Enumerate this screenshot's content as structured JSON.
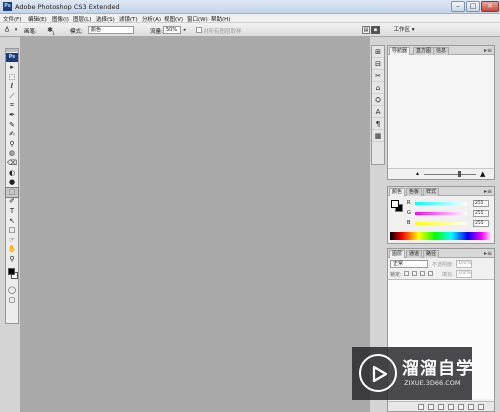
{
  "window": {
    "app_icon": "Ps",
    "title": "Adobe Photoshop CS3 Extended",
    "minimize": "–",
    "maximize": "□",
    "close": "✕"
  },
  "menu": [
    "文件(F)",
    "编辑(E)",
    "图像(I)",
    "图层(L)",
    "选择(S)",
    "滤镜(T)",
    "分析(A)",
    "视图(V)",
    "窗口(W)",
    "帮助(H)"
  ],
  "options_bar": {
    "brush_label": "画笔:",
    "brush_size": "1",
    "mode_label": "模式:",
    "mode_value": "颜色",
    "opacity_label": "流量:",
    "opacity_value": "50%",
    "sample_all_label": "对所有图层取样",
    "workspace_label": "工作区 ▾"
  },
  "toolbox": {
    "logo": "Ps",
    "tools": [
      "▸",
      "⬚",
      "ℓ",
      "⟋",
      "⌗",
      "✒",
      "✎",
      "✍",
      "⚲",
      "◍",
      "⌫",
      "◐",
      "●",
      "⬚",
      "✐",
      "T",
      "↖",
      "□",
      "☞",
      "✋",
      "⚲",
      "▣"
    ],
    "selected_index": 13,
    "extra": [
      "◯",
      "▢"
    ]
  },
  "icon_strip": [
    "⊞",
    "⊟",
    "✂",
    "⌂",
    "⛭",
    "A",
    "¶",
    "▦"
  ],
  "navigator": {
    "tabs": [
      "导航器",
      "直方图",
      "信息"
    ],
    "menu": "▸≡",
    "zoom_min": "▴",
    "zoom_max": "▲"
  },
  "color_panel": {
    "tabs": [
      "颜色",
      "色板",
      "样式"
    ],
    "menu": "▸≡",
    "channels": [
      {
        "label": "R",
        "value": "255"
      },
      {
        "label": "G",
        "value": "255"
      },
      {
        "label": "B",
        "value": "255"
      }
    ]
  },
  "layers_panel": {
    "tabs": [
      "图层",
      "通道",
      "路径"
    ],
    "menu": "▸≡",
    "blend_mode": "正常",
    "opacity_label": "不透明度:",
    "opacity_value": "100%",
    "lock_label": "锁定:",
    "fill_label": "填充:",
    "fill_value": "100%"
  },
  "watermark": {
    "title": "溜溜自学",
    "url": "ZIXUE.3D66.COM"
  }
}
